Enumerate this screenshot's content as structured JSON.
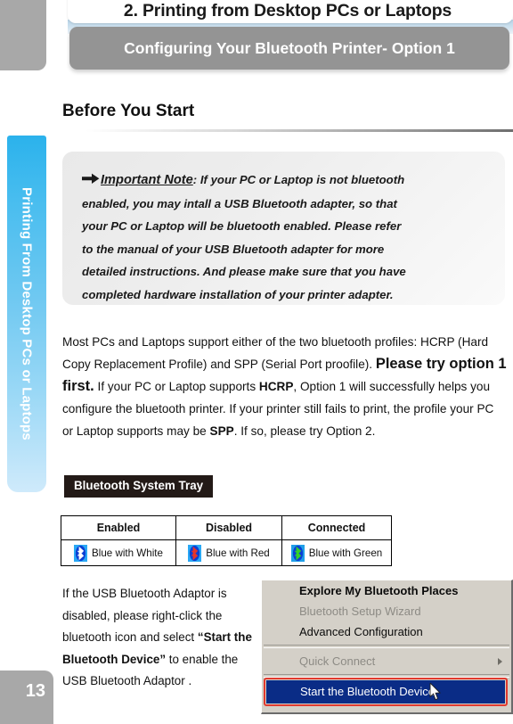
{
  "header": {
    "chapter_title": "2. Printing from Desktop PCs or Laptops",
    "subtitle": "Configuring Your Bluetooth Printer- Option  1"
  },
  "side_tab": {
    "label": "Printing From Desktop PCs or Laptops"
  },
  "section": {
    "heading": "Before You Start"
  },
  "note": {
    "arrow_icon": "right-arrow-icon",
    "label": "Important Note",
    "colon": ":",
    "lines": [
      "If your PC or Laptop is not bluetooth",
      "enabled, you may intall a USB Bluetooth adapter, so that",
      "your PC or Laptop will be bluetooth enabled. Please refer",
      "to the manual of your USB Bluetooth adapter for more",
      "detailed instructions. And please make sure that you have",
      "completed hardware installation of your printer adapter."
    ]
  },
  "body": {
    "part1": "Most PCs and Laptops support either of the two bluetooth profiles: HCRP (Hard Copy Replacement Profile) and SPP (Serial Port proofile). ",
    "emphasis1": "Please try option 1 first.",
    "part2": " If your PC or Laptop supports ",
    "bold1": "HCRP",
    "part3": ", Option 1 will successfully helps you configure the bluetooth printer. If your printer still fails to print, the profile your PC or Laptop supports may be ",
    "bold2": "SPP",
    "part4": ". If so, please try Option 2."
  },
  "tray_bar": {
    "label": "Bluetooth System Tray"
  },
  "status_table": {
    "headers": [
      "Enabled",
      "Disabled",
      "Connected"
    ],
    "rows": [
      [
        {
          "icon": "bluetooth-icon-white",
          "icon_bg": "#0b7ee8",
          "glyph_color": "#ffffff",
          "label": "Blue with White"
        },
        {
          "icon": "bluetooth-icon-red",
          "icon_bg": "#29a8f5",
          "glyph_color": "#e8342a",
          "label": "Blue with Red"
        },
        {
          "icon": "bluetooth-icon-green",
          "icon_bg": "#1f9fe8",
          "glyph_color": "#33d12a",
          "label": "Blue with Green"
        }
      ]
    ]
  },
  "bottom_text": {
    "part1": "If the USB Bluetooth Adaptor is disabled, please right-click the bluetooth icon and select ",
    "bold1": "“Start the Bluetooth Device”",
    "part2": " to enable the USB Bluetooth Adaptor ."
  },
  "context_menu": {
    "items": [
      {
        "label": "Explore My Bluetooth Places",
        "state": "bold"
      },
      {
        "label": "Bluetooth Setup Wizard",
        "state": "disabled"
      },
      {
        "label": "Advanced Configuration",
        "state": "normal"
      },
      {
        "label": "Quick Connect",
        "state": "disabled",
        "submenu": true
      }
    ],
    "highlighted_item": "Start the Bluetooth Device",
    "highlight_color": "#0a2c86",
    "callout_color": "#e03a2f",
    "cursor_icon": "mouse-pointer-icon"
  },
  "footer": {
    "page_number": "13"
  }
}
